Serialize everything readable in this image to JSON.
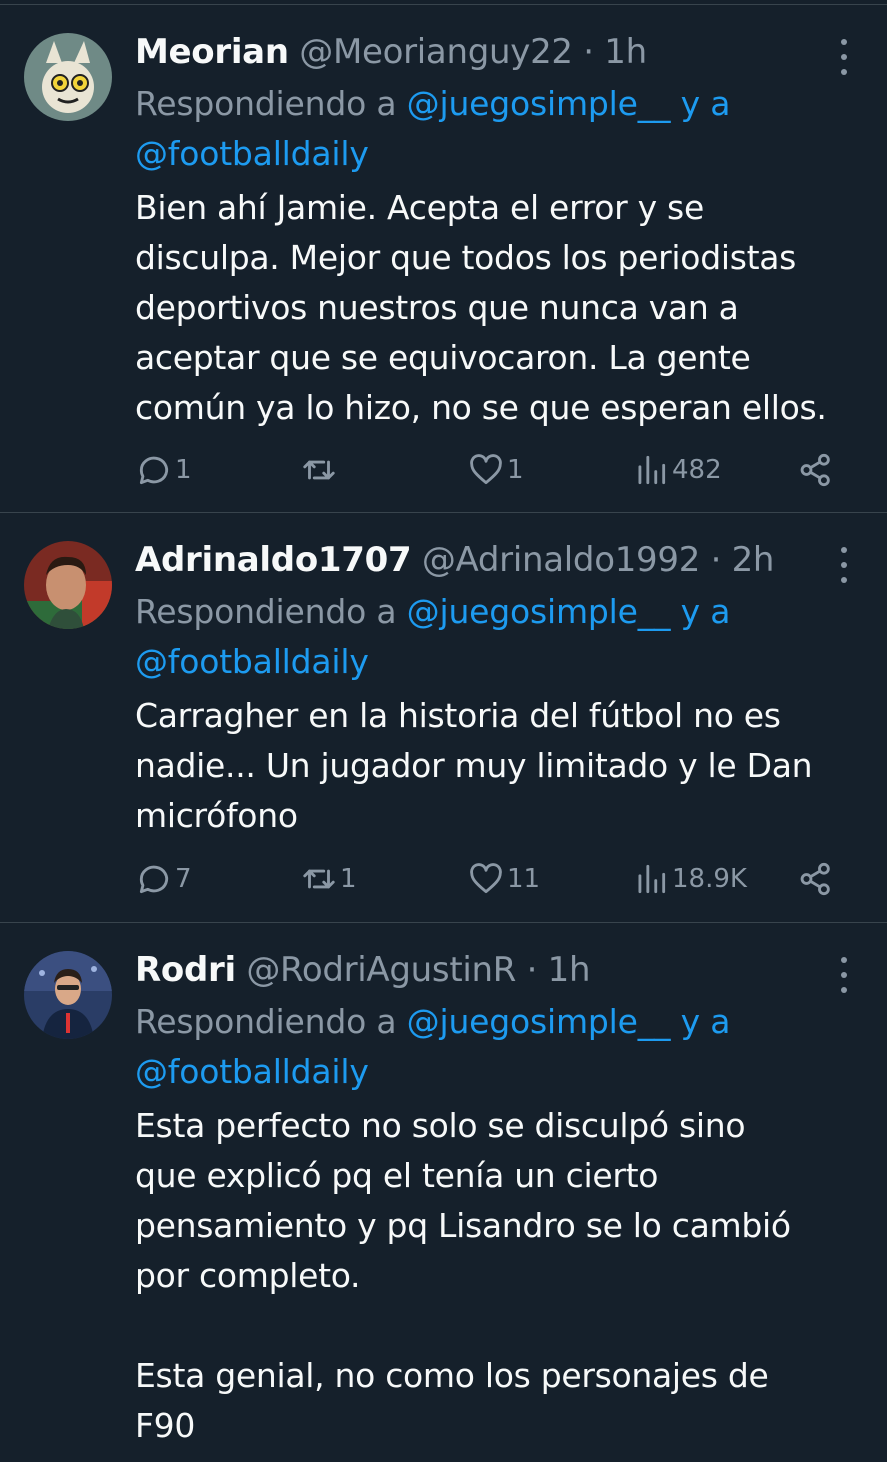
{
  "tweets": [
    {
      "name": "Meorian",
      "handle": "@Meorianguy22",
      "time": "· 1h",
      "reply_prefix": "Respondiendo a ",
      "reply_mention1": "@juegosimple__",
      "reply_and": " y a",
      "reply_mention2": "@footballdaily",
      "text": "Bien ahí Jamie. Acepta el error y se\ndisculpa. Mejor que todos los periodistas\ndeportivos nuestros que nunca van a\naceptar que se equivocaron. La gente\ncomún ya lo hizo, no se que esperan ellos.",
      "replies": "1",
      "retweets": "",
      "likes": "1",
      "views": "482"
    },
    {
      "name": "Adrinaldo1707",
      "handle": "@Adrinaldo1992",
      "time": "· 2h",
      "reply_prefix": "Respondiendo a ",
      "reply_mention1": "@juegosimple__",
      "reply_and": " y a",
      "reply_mention2": "@footballdaily",
      "text": "Carragher en la historia del fútbol no es\nnadie... Un jugador muy limitado y le Dan\nmicrófono",
      "replies": "7",
      "retweets": "1",
      "likes": "11",
      "views": "18.9K"
    },
    {
      "name": "Rodri",
      "handle": "@RodriAgustinR",
      "time": "· 1h",
      "reply_prefix": "Respondiendo a ",
      "reply_mention1": "@juegosimple__",
      "reply_and": " y a",
      "reply_mention2": "@footballdaily",
      "text": "Esta perfecto no solo se disculpó sino\nque explicó pq el tenía un cierto\npensamiento y pq Lisandro se lo cambió\npor completo.\n\nEsta genial, no como los personajes de\nF90"
    }
  ],
  "icons": {
    "reply": "speech-bubble-icon",
    "retweet": "retweet-arrows-icon",
    "like": "heart-icon",
    "views": "bar-chart-icon",
    "share": "share-nodes-icon",
    "more": "vertical-ellipsis-icon"
  },
  "colors": {
    "background": "#15202b",
    "text": "#f7f9f9",
    "secondary": "#8b98a5",
    "accent": "#1d9bf0",
    "divider": "#38444d"
  }
}
